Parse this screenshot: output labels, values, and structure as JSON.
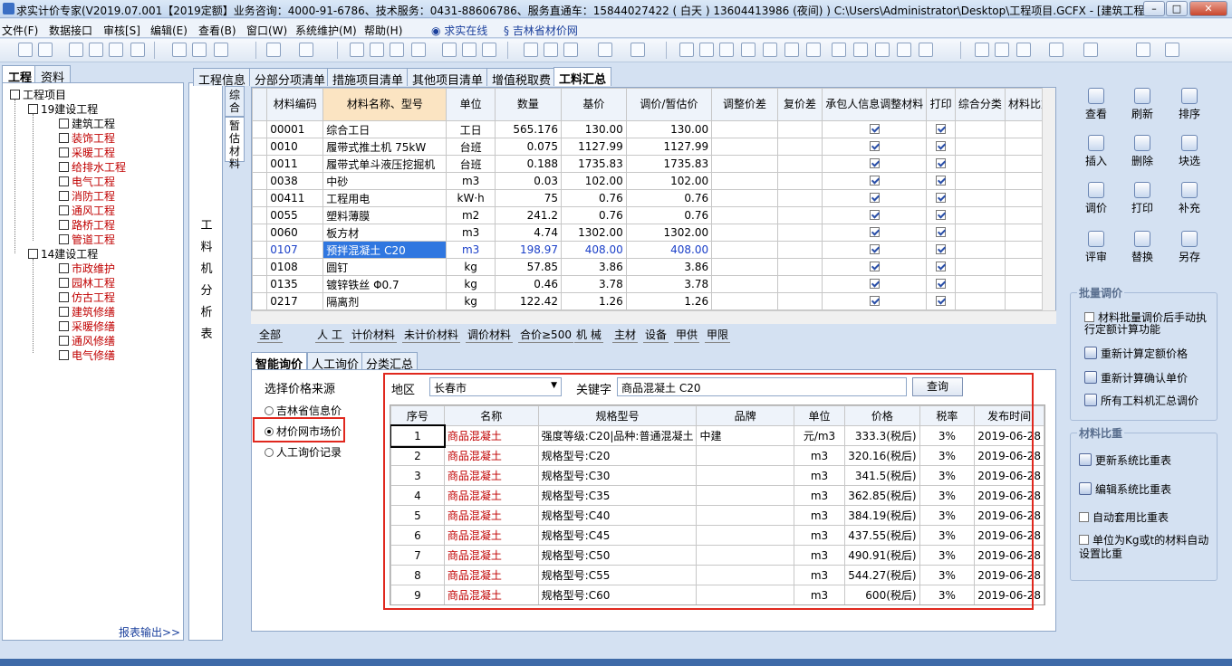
{
  "window": {
    "title": "求实计价专家(V2019.07.001【2019定额】业务咨询：4000-91-6786、技术服务：0431-88606786、服务直通车：15844027422 ( 白天 ) 13604413986 (夜间) ) C:\\Users\\Administrator\\Desktop\\工程项目.GCFX - [建筑工程]",
    "min": "–",
    "max": "□",
    "close": "✕"
  },
  "menu": [
    "文件(F)",
    "数据接口",
    "审核[S]",
    "编辑(E)",
    "查看(B)",
    "窗口(W)",
    "系统维护(M)",
    "帮助(H)",
    "求实在线",
    "吉林省材价网"
  ],
  "left_tabs": [
    "工程",
    "资料"
  ],
  "tree": {
    "root": "工程项目",
    "g1": "19建设工程",
    "g1_items": [
      "建筑工程",
      "装饰工程",
      "采暖工程",
      "给排水工程",
      "电气工程",
      "消防工程",
      "通风工程",
      "路桥工程",
      "管道工程"
    ],
    "g2": "14建设工程",
    "g2_items": [
      "市政维护",
      "园林工程",
      "仿古工程",
      "建筑修缮",
      "采暖修缮",
      "通风修缮",
      "电气修缮"
    ]
  },
  "report_output": "报表输出>>",
  "vertical_label": [
    "工",
    "料",
    "机",
    "分",
    "析",
    "表"
  ],
  "main_tabs": [
    "工程信息",
    "分部分项清单",
    "措施项目清单",
    "其他项目清单",
    "增值税取费",
    "工料汇总"
  ],
  "side_tabs": [
    "综合",
    "暂估材料"
  ],
  "grid1": {
    "headers": [
      "材料编码",
      "材料名称、型号",
      "单位",
      "数量",
      "基价",
      "调价/暂估价",
      "调整价差",
      "复价差",
      "承包人信息调整材料",
      "打印",
      "综合分类",
      "材料比重"
    ],
    "rows": [
      [
        "00001",
        "综合工日",
        "工日",
        "565.176",
        "130.00",
        "130.00"
      ],
      [
        "0010",
        "履带式推土机 75kW",
        "台班",
        "0.075",
        "1127.99",
        "1127.99"
      ],
      [
        "0011",
        "履带式单斗液压挖掘机",
        "台班",
        "0.188",
        "1735.83",
        "1735.83"
      ],
      [
        "0038",
        "中砂",
        "m3",
        "0.03",
        "102.00",
        "102.00"
      ],
      [
        "00411",
        "工程用电",
        "kW·h",
        "75",
        "0.76",
        "0.76"
      ],
      [
        "0055",
        "塑料薄膜",
        "m2",
        "241.2",
        "0.76",
        "0.76"
      ],
      [
        "0060",
        "板方材",
        "m3",
        "4.74",
        "1302.00",
        "1302.00"
      ],
      [
        "0107",
        "预拌混凝土 C20",
        "m3",
        "198.97",
        "408.00",
        "408.00"
      ],
      [
        "0108",
        "圆钉",
        "kg",
        "57.85",
        "3.86",
        "3.86"
      ],
      [
        "0135",
        "镀锌铁丝 Φ0.7",
        "kg",
        "0.46",
        "3.78",
        "3.78"
      ],
      [
        "0217",
        "隔离剂",
        "kg",
        "122.42",
        "1.26",
        "1.26"
      ]
    ]
  },
  "filter_tabs": [
    "全部",
    "人 工",
    "计价材料",
    "未计价材料",
    "调价材料",
    "合价≥500",
    "机 械",
    "主材",
    "设备",
    "甲供",
    "甲限"
  ],
  "lower_tabs": [
    "智能询价",
    "人工询价",
    "分类汇总"
  ],
  "price_source": {
    "label": "选择价格来源",
    "options": [
      "吉林省信息价",
      "材价网市场价",
      "人工询价记录"
    ],
    "selected_index": 1
  },
  "search": {
    "region_label": "地区",
    "region_value": "长春市",
    "keyword_label": "关键字",
    "keyword_value": "商品混凝土 C20",
    "query_button": "查询"
  },
  "grid2": {
    "headers": [
      "序号",
      "名称",
      "规格型号",
      "品牌",
      "单位",
      "价格",
      "税率",
      "发布时间"
    ],
    "rows": [
      [
        "1",
        "商品混凝土",
        "强度等级:C20|品种:普通混凝土",
        "中建",
        "元/m3",
        "333.3(税后)",
        "3%",
        "2019-06-28"
      ],
      [
        "2",
        "商品混凝土",
        "规格型号:C20",
        "",
        "m3",
        "320.16(税后)",
        "3%",
        "2019-06-28"
      ],
      [
        "3",
        "商品混凝土",
        "规格型号:C30",
        "",
        "m3",
        "341.5(税后)",
        "3%",
        "2019-06-28"
      ],
      [
        "4",
        "商品混凝土",
        "规格型号:C35",
        "",
        "m3",
        "362.85(税后)",
        "3%",
        "2019-06-28"
      ],
      [
        "5",
        "商品混凝土",
        "规格型号:C40",
        "",
        "m3",
        "384.19(税后)",
        "3%",
        "2019-06-28"
      ],
      [
        "6",
        "商品混凝土",
        "规格型号:C45",
        "",
        "m3",
        "437.55(税后)",
        "3%",
        "2019-06-28"
      ],
      [
        "7",
        "商品混凝土",
        "规格型号:C50",
        "",
        "m3",
        "490.91(税后)",
        "3%",
        "2019-06-28"
      ],
      [
        "8",
        "商品混凝土",
        "规格型号:C55",
        "",
        "m3",
        "544.27(税后)",
        "3%",
        "2019-06-28"
      ],
      [
        "9",
        "商品混凝土",
        "规格型号:C60",
        "",
        "m3",
        "600(税后)",
        "3%",
        "2019-06-28"
      ]
    ]
  },
  "right_buttons": [
    "查看",
    "刷新",
    "排序",
    "插入",
    "删除",
    "块选",
    "调价",
    "打印",
    "补充",
    "评审",
    "替换",
    "另存"
  ],
  "batch_group": {
    "title": "批量调价",
    "check_label": "材料批量调价后手动执行定额计算功能",
    "items": [
      "重新计算定额价格",
      "重新计算确认单价",
      "所有工料机汇总调价"
    ]
  },
  "ratio_group": {
    "title": "材料比重",
    "items": [
      "更新系统比重表",
      "编辑系统比重表"
    ],
    "checks": [
      "自动套用比重表",
      "单位为Kg或t的材料自动设置比重"
    ]
  }
}
